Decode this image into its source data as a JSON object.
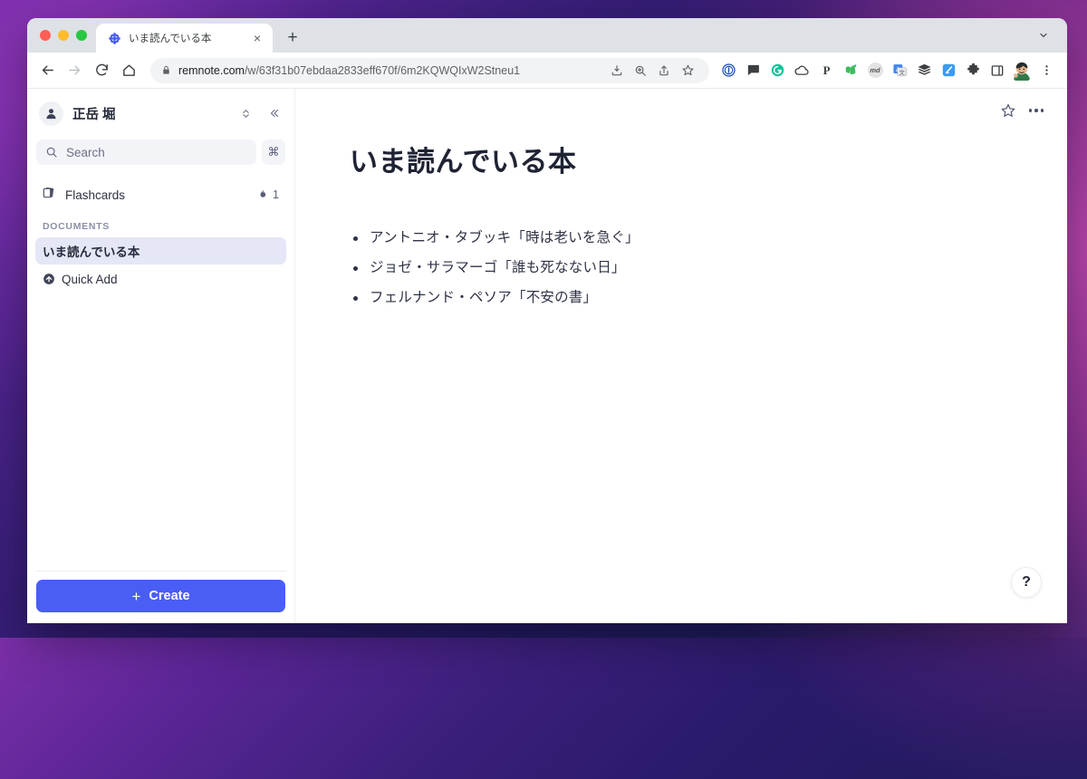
{
  "browser": {
    "tab": {
      "title": "いま読んでいる本",
      "favicon": "remnote-logo-icon",
      "close_label": "×"
    },
    "new_tab_label": "+",
    "tab_search_icon": "chevron-down-icon",
    "nav": {
      "back_icon": "arrow-left-icon",
      "forward_icon": "arrow-right-icon",
      "reload_icon": "reload-icon",
      "home_icon": "home-icon"
    },
    "omnibox": {
      "lock_icon": "lock-icon",
      "domain": "remnote.com",
      "path": "/w/63f31b07ebdaa2833eff670f/6m2KQWQIxW2Stneu1",
      "actions": [
        "install-icon",
        "zoom-icon",
        "share-icon",
        "bookmark-star-icon"
      ]
    },
    "extensions": [
      {
        "name": "1password-icon",
        "label": ""
      },
      {
        "name": "chat-bubble-icon",
        "label": ""
      },
      {
        "name": "grammarly-icon",
        "label": ""
      },
      {
        "name": "cloud-icon",
        "label": ""
      },
      {
        "name": "pocket-icon",
        "label": "P"
      },
      {
        "name": "evernote-icon",
        "label": ""
      },
      {
        "name": "markdown-icon",
        "label": "md"
      },
      {
        "name": "google-translate-icon",
        "label": ""
      },
      {
        "name": "buffer-layers-icon",
        "label": ""
      },
      {
        "name": "blue-app-icon",
        "label": ""
      },
      {
        "name": "puzzle-extensions-icon",
        "label": ""
      },
      {
        "name": "side-panel-icon",
        "label": ""
      }
    ],
    "profile_avatar": "user-avatar-icon",
    "menu_icon": "kebab-menu-icon"
  },
  "sidebar": {
    "user": {
      "name": "正岳 堀",
      "avatar_icon": "person-icon",
      "switcher_icon": "chevron-updown-icon",
      "collapse_icon": "chevron-double-left-icon"
    },
    "search": {
      "placeholder": "Search",
      "icon": "search-icon",
      "shortcut": "⌘"
    },
    "flashcards": {
      "label": "Flashcards",
      "icon": "cards-icon",
      "streak_icon": "flame-icon",
      "streak_count": "1"
    },
    "documents_label": "DOCUMENTS",
    "documents": [
      {
        "label": "いま読んでいる本",
        "active": true
      },
      {
        "label": "Quick Add",
        "icon": "arrow-up-circle-icon",
        "active": false
      }
    ],
    "create_button": {
      "label": "Create",
      "plus": "+",
      "color": "#4a5df5"
    }
  },
  "content": {
    "header_actions": {
      "favorite_icon": "star-icon",
      "more_icon": "more-horizontal-icon"
    },
    "title": "いま読んでいる本",
    "bullets": [
      "アントニオ・タブッキ「時は老いを急ぐ」",
      "ジョゼ・サラマーゴ「誰も死なない日」",
      "フェルナンド・ペソア「不安の書」"
    ],
    "help_button": "?"
  }
}
